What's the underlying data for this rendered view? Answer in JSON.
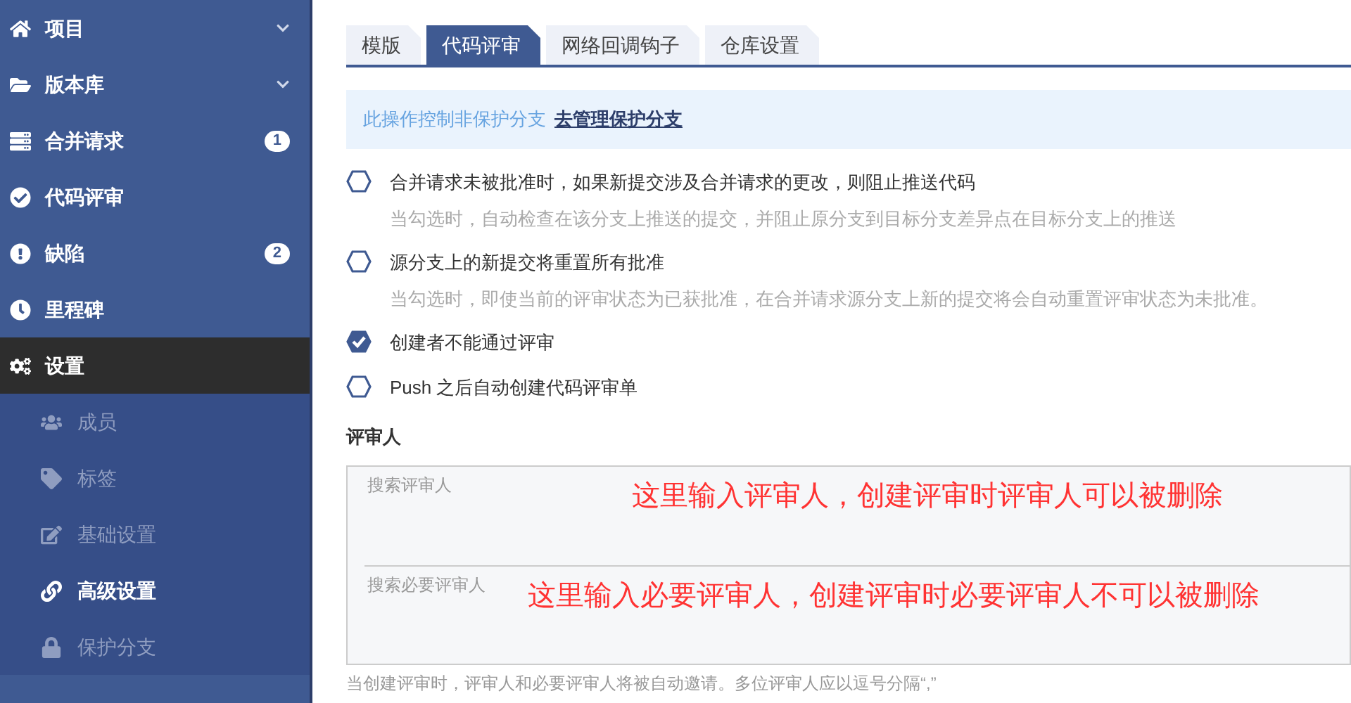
{
  "sidebar": {
    "items": [
      {
        "label": "项目",
        "expandable": true,
        "selected": false
      },
      {
        "label": "版本库",
        "expandable": true,
        "selected": false
      },
      {
        "label": "合并请求",
        "badge": "1",
        "selected": false
      },
      {
        "label": "代码评审",
        "selected": false
      },
      {
        "label": "缺陷",
        "badge": "2",
        "selected": false
      },
      {
        "label": "里程碑",
        "selected": false
      },
      {
        "label": "设置",
        "selected": true,
        "children": [
          {
            "label": "成员",
            "selected": false
          },
          {
            "label": "标签",
            "selected": false
          },
          {
            "label": "基础设置",
            "selected": false
          },
          {
            "label": "高级设置",
            "selected": true
          },
          {
            "label": "保护分支",
            "selected": false
          }
        ]
      }
    ]
  },
  "tabs": [
    {
      "label": "模版",
      "selected": false
    },
    {
      "label": "代码评审",
      "selected": true
    },
    {
      "label": "网络回调钩子",
      "selected": false
    },
    {
      "label": "仓库设置",
      "selected": false
    }
  ],
  "notice": {
    "text": "此操作控制非保护分支",
    "link": "去管理保护分支"
  },
  "options": [
    {
      "label": "合并请求未被批准时，如果新提交涉及合并请求的更改，则阻止推送代码",
      "hint": "当勾选时，自动检查在该分支上推送的提交，并阻止原分支到目标分支差异点在目标分支上的推送",
      "checked": false
    },
    {
      "label": "源分支上的新提交将重置所有批准",
      "hint": "当勾选时，即使当前的评审状态为已获批准，在合并请求源分支上新的提交将会自动重置评审状态为未批准。",
      "checked": false
    },
    {
      "label": "创建者不能通过评审",
      "checked": true
    },
    {
      "label": "Push 之后自动创建代码评审单",
      "checked": false
    }
  ],
  "reviewers": {
    "title": "评审人",
    "fields": [
      {
        "placeholder": "搜索评审人",
        "annotation": "这里输入评审人，创建评审时评审人可以被删除"
      },
      {
        "placeholder": "搜索必要评审人",
        "annotation": "这里输入必要评审人，创建评审时必要评审人不可以被删除"
      }
    ],
    "help": "当创建评审时，评审人和必要评审人将被自动邀请。多位评审人应以逗号分隔“,”"
  }
}
